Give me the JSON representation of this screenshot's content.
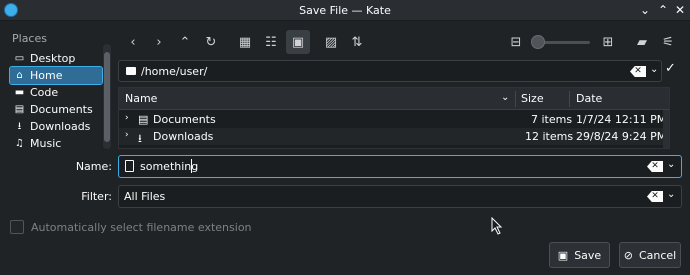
{
  "window": {
    "title": "Save File — Kate"
  },
  "places": {
    "header": "Places",
    "items": [
      {
        "label": "Desktop",
        "icon": "desktop-icon"
      },
      {
        "label": "Home",
        "icon": "home-icon",
        "selected": true
      },
      {
        "label": "Code",
        "icon": "folder-icon"
      },
      {
        "label": "Documents",
        "icon": "documents-icon"
      },
      {
        "label": "Downloads",
        "icon": "download-icon"
      },
      {
        "label": "Music",
        "icon": "music-icon"
      }
    ]
  },
  "path": {
    "value": "/home/user/"
  },
  "files": {
    "columns": {
      "name": "Name",
      "size": "Size",
      "date": "Date"
    },
    "rows": [
      {
        "name": "Documents",
        "size": "7 items",
        "date": "1/7/24 12:11 PM",
        "icon": "documents-icon"
      },
      {
        "name": "Downloads",
        "size": "12 items",
        "date": "29/8/24 9:24 PM",
        "icon": "download-icon"
      }
    ]
  },
  "form": {
    "name_label": "Name:",
    "name_value": "something",
    "filter_label": "Filter:",
    "filter_value": "All Files",
    "auto_extension_label": "Automatically select filename extension"
  },
  "buttons": {
    "save": "Save",
    "cancel": "Cancel"
  },
  "colors": {
    "accent": "#3daee9",
    "background": "#202326",
    "selection": "#2f6d97"
  }
}
